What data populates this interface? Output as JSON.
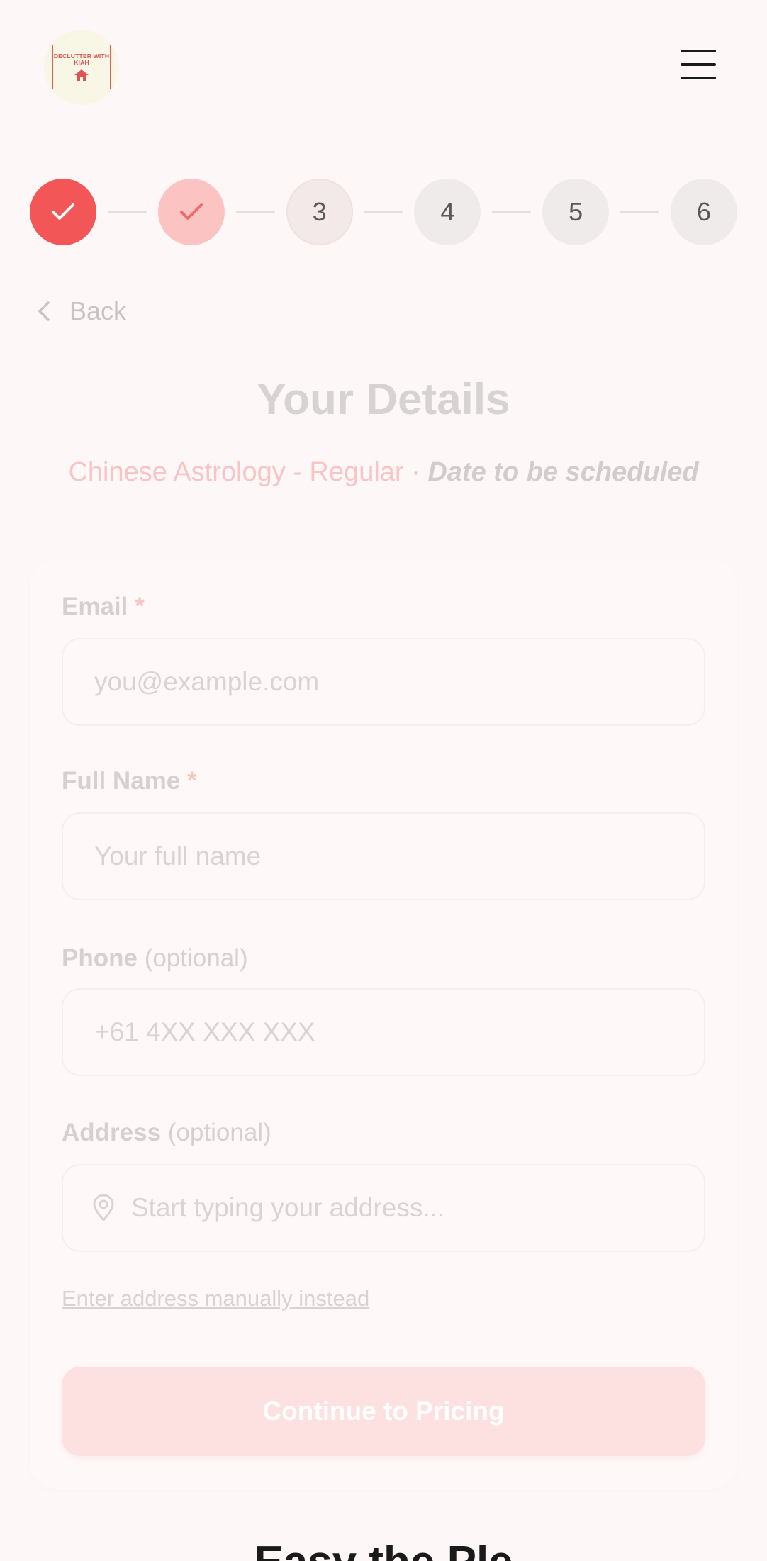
{
  "header": {
    "logo_text": "DECLUTTER WITH KIAH",
    "menu_icon": "hamburger-menu-icon"
  },
  "stepper": {
    "steps": [
      {
        "label": "",
        "state": "completed",
        "icon": "check-icon"
      },
      {
        "label": "",
        "state": "completed",
        "icon": "check-icon"
      },
      {
        "label": "3",
        "state": "current"
      },
      {
        "label": "4",
        "state": "upcoming"
      },
      {
        "label": "5",
        "state": "upcoming"
      },
      {
        "label": "6",
        "state": "upcoming"
      }
    ]
  },
  "nav": {
    "back_label": "Back"
  },
  "page": {
    "title": "Your Details",
    "service": "Chinese Astrology - Regular",
    "separator": "·",
    "date": "Date to be scheduled"
  },
  "form": {
    "email": {
      "label": "Email",
      "required_mark": "*",
      "placeholder": "you@example.com"
    },
    "full_name": {
      "label": "Full Name",
      "required_mark": "*",
      "placeholder": "Your full name"
    },
    "phone": {
      "label": "Phone",
      "optional": "(optional)",
      "placeholder": "+61 4XX XXX XXX"
    },
    "address": {
      "label": "Address",
      "optional": "(optional)",
      "placeholder": "Start typing your address..."
    },
    "manual_link": "Enter address manually instead",
    "submit_label": "Continue to Pricing"
  },
  "bottom": {
    "heading": "Easy the Ple"
  },
  "colors": {
    "accent": "#f25656",
    "accent_light": "#fcc3c3",
    "background": "#fdf7f7"
  }
}
